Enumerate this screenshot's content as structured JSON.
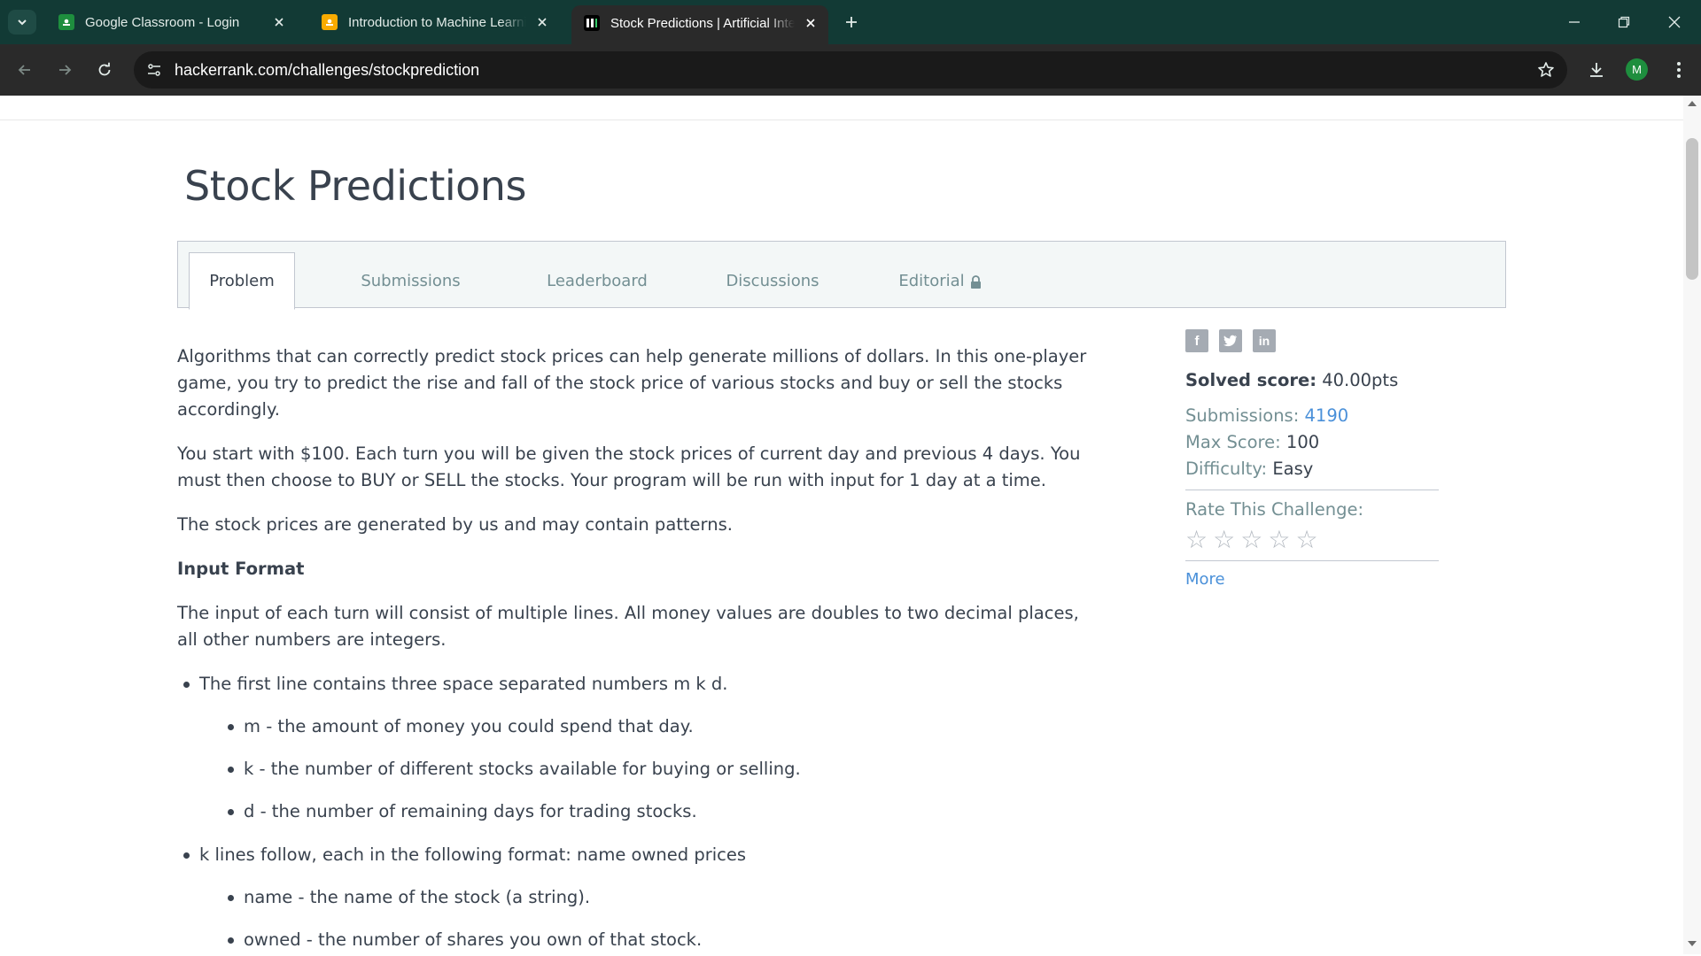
{
  "browser": {
    "tabs": [
      {
        "title": "Google Classroom - Login",
        "favicon": "google-classroom-icon",
        "color": "#1e8e3e"
      },
      {
        "title": "Introduction to Machine Learning",
        "favicon": "google-classroom-icon",
        "color": "#f9ab00"
      },
      {
        "title": "Stock Predictions | Artificial Intelligence",
        "favicon": "hackerrank-icon",
        "color": "#ffffff",
        "active": true
      }
    ],
    "url": "hackerrank.com/challenges/stockprediction",
    "profile_initial": "M"
  },
  "page": {
    "title": "Stock Predictions",
    "tabs": [
      "Problem",
      "Submissions",
      "Leaderboard",
      "Discussions",
      "Editorial"
    ],
    "active_tab": "Problem"
  },
  "problem": {
    "p1": "Algorithms that can correctly predict stock prices can help generate millions of dollars. In this one-player game, you try to predict the rise and fall of the stock price of various stocks and buy or sell the stocks accordingly.",
    "p2": "You start with $100. Each turn you will be given the stock prices of current day and previous 4 days. You must then choose to BUY or SELL the stocks. Your program will be run with input for 1 day at a time.",
    "p3": "The stock prices are generated by us and may contain patterns.",
    "input_heading": "Input Format",
    "p4": "The input of each turn will consist of multiple lines. All money values are doubles to two decimal places, all other numbers are integers.",
    "bullet1": "The first line contains three space separated numbers m k d.",
    "bullet1_sub": [
      "m - the amount of money you could spend that day.",
      "k - the number of different stocks available for buying or selling.",
      "d - the number of remaining days for trading stocks."
    ],
    "bullet2": "k lines follow, each in the following format: name owned prices",
    "bullet2_sub": [
      "name - the name of the stock (a string).",
      "owned - the number of shares you own of that stock."
    ]
  },
  "sidebar": {
    "solved_label": "Solved score:",
    "solved_value": "40.00pts",
    "submissions_label": "Submissions:",
    "submissions_value": "4190",
    "max_label": "Max Score:",
    "max_value": "100",
    "difficulty_label": "Difficulty:",
    "difficulty_value": "Easy",
    "rate_label": "Rate This Challenge:",
    "rating": 0,
    "more_label": "More"
  }
}
